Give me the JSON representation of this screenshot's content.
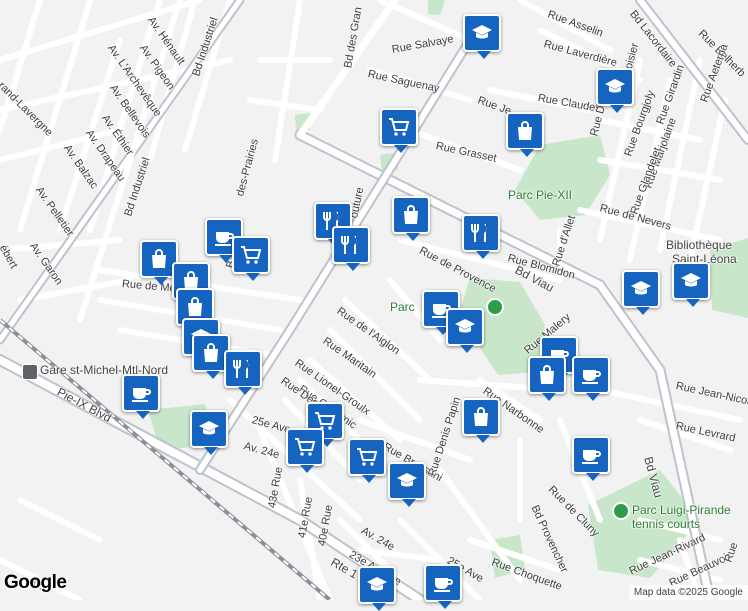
{
  "map": {
    "streets": [
      {
        "id": "bd-industriel-1",
        "label": "Bd Industriel"
      },
      {
        "id": "bd-industriel-2",
        "label": "Bd Industriel"
      },
      {
        "id": "av-henault",
        "label": "Av. Hénault"
      },
      {
        "id": "av-pigeon",
        "label": "Av. Pigeon"
      },
      {
        "id": "av-archeveque",
        "label": "Av. L'Archevêque"
      },
      {
        "id": "av-bellevois",
        "label": "Av. Bellevois"
      },
      {
        "id": "av-ethier",
        "label": "Av. Éthier"
      },
      {
        "id": "av-drapeau",
        "label": "Av. Drapeau"
      },
      {
        "id": "av-balzac",
        "label": "Av. Balzac"
      },
      {
        "id": "av-pelletier",
        "label": "Av. Pelletier"
      },
      {
        "id": "av-garon",
        "label": "Av. Garon"
      },
      {
        "id": "bertrand-lavergne",
        "label": "rand-Lavergne"
      },
      {
        "id": "hebert",
        "label": "ébert"
      },
      {
        "id": "bd-des-grandes",
        "label": "Bd des Gran"
      },
      {
        "id": "des-prairies",
        "label": "des-Prairies"
      },
      {
        "id": "bd-prairies-b",
        "label": "B"
      },
      {
        "id": "rue-salvaye",
        "label": "Rue Salvaye"
      },
      {
        "id": "rue-saguenay",
        "label": "Rue Saguenay"
      },
      {
        "id": "rue-grasset",
        "label": "Rue Grasset"
      },
      {
        "id": "rue-je",
        "label": "Rue Je"
      },
      {
        "id": "rue-asselin",
        "label": "Rue Asselin"
      },
      {
        "id": "rue-laverdiere",
        "label": "Rue Laverdière"
      },
      {
        "id": "rue-claudel",
        "label": "Rue Claudel"
      },
      {
        "id": "rue-dujarie",
        "label": "Rue Dujarié"
      },
      {
        "id": "lavoisier",
        "label": "Lavoisier"
      },
      {
        "id": "bd-lacordaire",
        "label": "Bd Lacordaire"
      },
      {
        "id": "rue-belherb",
        "label": "Rue Belherb"
      },
      {
        "id": "rue-girardin",
        "label": "Rue Girardin"
      },
      {
        "id": "rue-aeterna",
        "label": "Rue Aeterna"
      },
      {
        "id": "rue-bourgjoly",
        "label": "Rue Bourgjoly"
      },
      {
        "id": "rue-marjolaine",
        "label": "Rue Marjolaine"
      },
      {
        "id": "rue-glandelet",
        "label": "Rue Glandelet"
      },
      {
        "id": "rue-de-nevers",
        "label": "Rue de Nevers"
      },
      {
        "id": "rue-d-allet",
        "label": "Rue d'Allet"
      },
      {
        "id": "rue-blomidon",
        "label": "Rue Blomidon"
      },
      {
        "id": "bd-viau-1",
        "label": "Bd Viau"
      },
      {
        "id": "bd-viau-2",
        "label": "Bd Viau"
      },
      {
        "id": "rue-de-provence",
        "label": "Rue de Provence"
      },
      {
        "id": "couture",
        "label": "outure"
      },
      {
        "id": "rue-de-mea",
        "label": "Rue de Mea"
      },
      {
        "id": "rue-de-l-aiglon",
        "label": "Rue de l'Aiglon"
      },
      {
        "id": "rue-maritain",
        "label": "Rue Maritain"
      },
      {
        "id": "rue-lionel-groulx",
        "label": "Rue Lionel-Groulx"
      },
      {
        "id": "rue-copernic",
        "label": "Rue Copernic"
      },
      {
        "id": "rue-descartes",
        "label": "Rue Descart"
      },
      {
        "id": "rue-malery",
        "label": "Rue Malery"
      },
      {
        "id": "rue-narbonne",
        "label": "Rue Narbonne"
      },
      {
        "id": "rue-jean-nicolet",
        "label": "Rue Jean-Nicolet"
      },
      {
        "id": "rue-levrard",
        "label": "Rue Levrard"
      },
      {
        "id": "rue-bressani",
        "label": "Rue Bressani"
      },
      {
        "id": "rue-denis-papin",
        "label": "Rue Denis Papin"
      },
      {
        "id": "rue-de-cluny",
        "label": "Rue de Cluny"
      },
      {
        "id": "bd-provencher",
        "label": "Bd Provencher"
      },
      {
        "id": "rue-choquette",
        "label": "Rue Choquette"
      },
      {
        "id": "rue-jean-rivard",
        "label": "Rue Jean-Rivard"
      },
      {
        "id": "rue-beauvoir",
        "label": "Rue Beauvoir"
      },
      {
        "id": "rue-ferland",
        "label": "Rue"
      },
      {
        "id": "av-25e-1",
        "label": "25e Ave"
      },
      {
        "id": "av-24e-1",
        "label": "Av. 24e"
      },
      {
        "id": "rue-43e",
        "label": "43e Rue"
      },
      {
        "id": "rue-41e",
        "label": "41e Rue"
      },
      {
        "id": "rue-40e",
        "label": "40e Rue"
      },
      {
        "id": "av-24e-2",
        "label": "Av. 24e"
      },
      {
        "id": "av-23e",
        "label": "23e Avenue"
      },
      {
        "id": "av-25e-2",
        "label": "25e Ave"
      },
      {
        "id": "pie-ix",
        "label": "Pie-IX Blvd"
      },
      {
        "id": "rte-1",
        "label": "Rte 1"
      },
      {
        "id": "av-corner",
        "label": "Av."
      }
    ],
    "places": {
      "parc_pie_xii": "Parc Pie-XII",
      "parc_center": "Parc",
      "bibliotheque": "Bibliothèque",
      "saint_leonard": "Saint-Léona",
      "parc_luigi": "Parc Luigi-Pirande",
      "tennis": "tennis courts",
      "gare": "Gare st-Michel-Mtl-Nord"
    },
    "markers": [
      {
        "id": "m1",
        "icon": "school-icon"
      },
      {
        "id": "m2",
        "icon": "school-icon"
      },
      {
        "id": "m3",
        "icon": "shopping-cart-icon"
      },
      {
        "id": "m4",
        "icon": "shopping-bag-icon"
      },
      {
        "id": "m5",
        "icon": "cafe-icon"
      },
      {
        "id": "m6",
        "icon": "shopping-cart-icon"
      },
      {
        "id": "m7",
        "icon": "restaurant-icon"
      },
      {
        "id": "m8",
        "icon": "restaurant-icon"
      },
      {
        "id": "m9",
        "icon": "shopping-bag-icon"
      },
      {
        "id": "m10",
        "icon": "restaurant-icon"
      },
      {
        "id": "m11",
        "icon": "school-icon"
      },
      {
        "id": "m12",
        "icon": "school-icon"
      },
      {
        "id": "m13",
        "icon": "shopping-bag-icon"
      },
      {
        "id": "m14",
        "icon": "shopping-bag-icon"
      },
      {
        "id": "m15",
        "icon": "shopping-bag-icon"
      },
      {
        "id": "m16",
        "icon": "school-icon"
      },
      {
        "id": "m17",
        "icon": "shopping-bag-icon"
      },
      {
        "id": "m18",
        "icon": "restaurant-icon"
      },
      {
        "id": "m19",
        "icon": "cafe-icon"
      },
      {
        "id": "m20",
        "icon": "cafe-icon"
      },
      {
        "id": "m21",
        "icon": "school-icon"
      },
      {
        "id": "m22",
        "icon": "cafe-icon"
      },
      {
        "id": "m23",
        "icon": "shopping-bag-icon"
      },
      {
        "id": "m24",
        "icon": "cafe-icon"
      },
      {
        "id": "m25",
        "icon": "shopping-bag-icon"
      },
      {
        "id": "m26",
        "icon": "shopping-cart-icon"
      },
      {
        "id": "m27",
        "icon": "shopping-cart-icon"
      },
      {
        "id": "m28",
        "icon": "shopping-cart-icon"
      },
      {
        "id": "m29",
        "icon": "school-icon"
      },
      {
        "id": "m30",
        "icon": "cafe-icon"
      },
      {
        "id": "m31",
        "icon": "school-icon"
      },
      {
        "id": "m32",
        "icon": "cafe-icon"
      },
      {
        "id": "m33",
        "icon": "school-icon"
      }
    ],
    "colors": {
      "marker": "#1565c0",
      "park": "#c8e6c9",
      "road": "#ffffff",
      "major_road": "#bcc3cc",
      "rail": "#8a9099"
    }
  },
  "google_logo": "Google",
  "attribution": "Map data ©2025 Google"
}
